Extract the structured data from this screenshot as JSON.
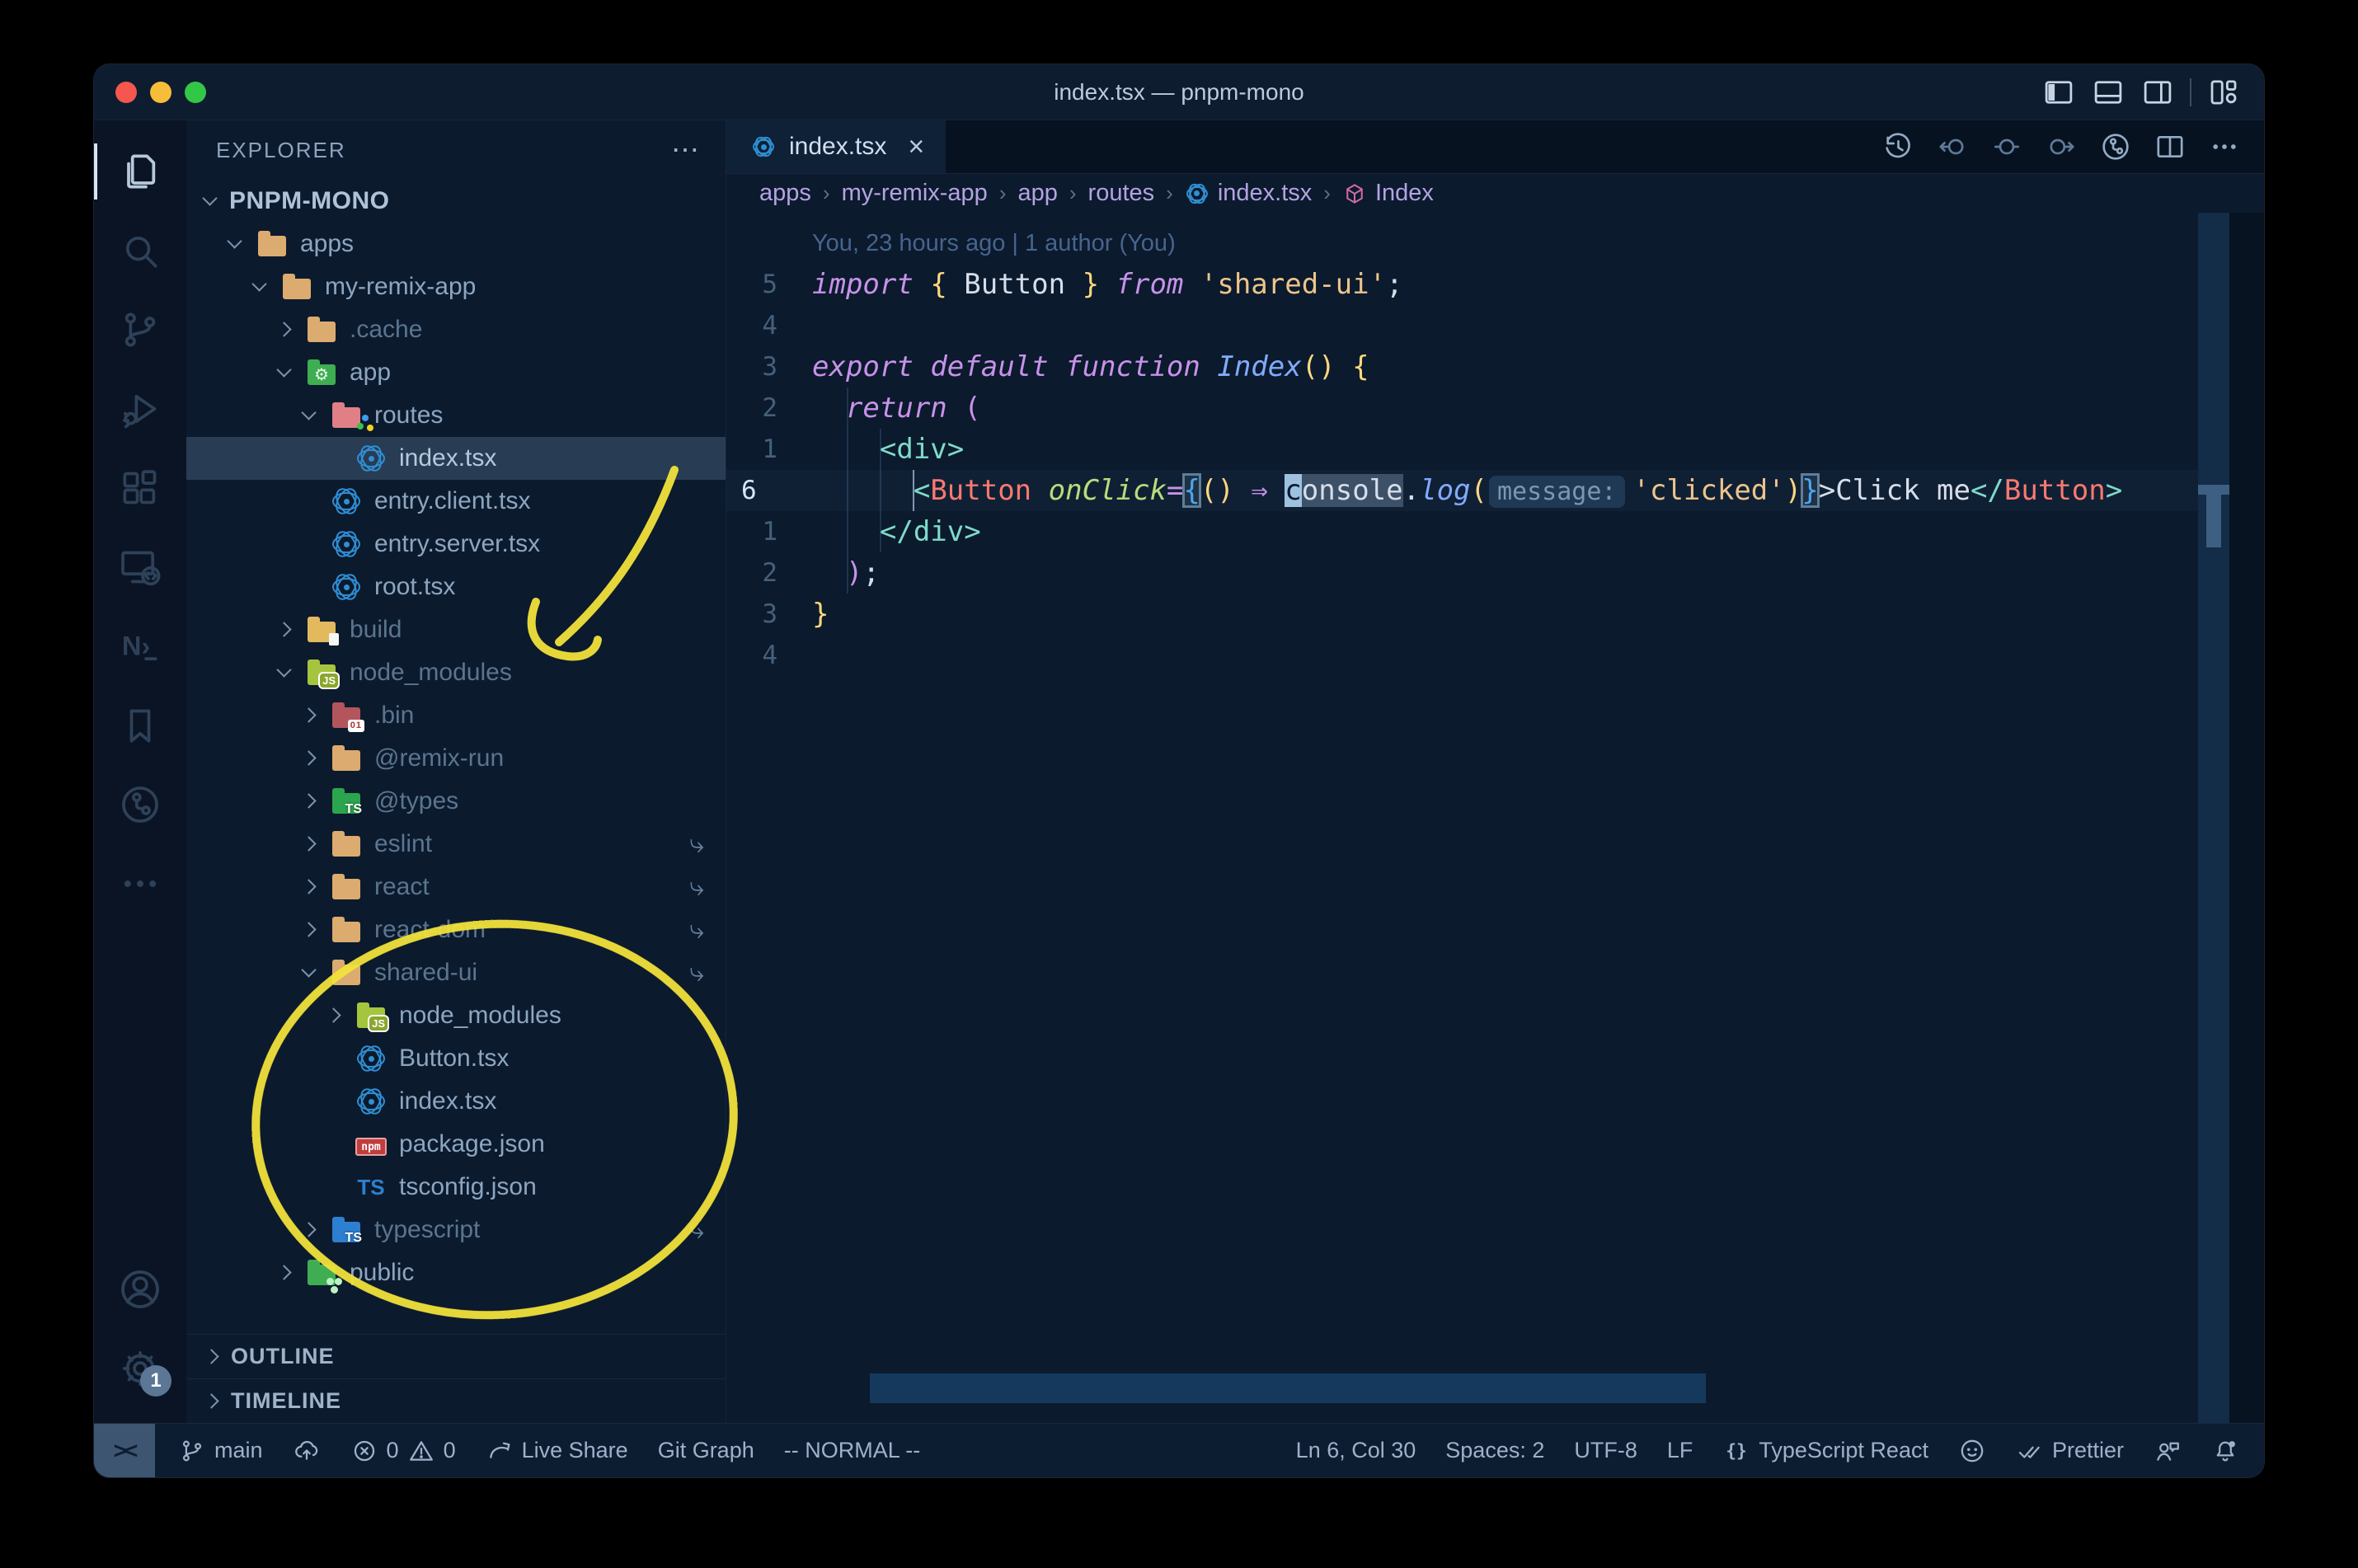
{
  "title_bar": {
    "title": "index.tsx — pnpm-mono",
    "window_controls": [
      "close",
      "minimize",
      "zoom"
    ],
    "layout_icons": [
      "toggle-primary-sidebar",
      "toggle-panel",
      "toggle-secondary-sidebar",
      "customize-layout"
    ]
  },
  "activity_bar": {
    "items": [
      {
        "name": "explorer",
        "icon": "files",
        "active": true
      },
      {
        "name": "search",
        "icon": "search"
      },
      {
        "name": "source-control",
        "icon": "branch"
      },
      {
        "name": "run-and-debug",
        "icon": "debug"
      },
      {
        "name": "extensions",
        "icon": "extensions"
      },
      {
        "name": "remote-explorer",
        "icon": "remote"
      },
      {
        "name": "nx-console",
        "icon": "nx"
      },
      {
        "name": "bookmarks",
        "icon": "bookmark"
      },
      {
        "name": "gitlens",
        "icon": "gitlens"
      },
      {
        "name": "additional-views",
        "icon": "more"
      }
    ],
    "bottom": [
      {
        "name": "accounts",
        "icon": "account"
      },
      {
        "name": "settings",
        "icon": "gear",
        "badge": "1"
      }
    ]
  },
  "sidebar": {
    "header": "EXPLORER",
    "sections": [
      {
        "label": "OUTLINE"
      },
      {
        "label": "TIMELINE"
      }
    ],
    "tree": [
      {
        "level": 0,
        "label": "PNPM-MONO",
        "chevron": "down",
        "root": true
      },
      {
        "level": 1,
        "label": "apps",
        "chevron": "down",
        "icon": "folder-tan"
      },
      {
        "level": 2,
        "label": "my-remix-app",
        "chevron": "down",
        "icon": "folder-tan"
      },
      {
        "level": 3,
        "label": ".cache",
        "chevron": "right",
        "icon": "folder-tan",
        "dim": true
      },
      {
        "level": 3,
        "label": "app",
        "chevron": "down",
        "icon": "folder-app"
      },
      {
        "level": 4,
        "label": "routes",
        "chevron": "down",
        "icon": "folder-routes"
      },
      {
        "level": 5,
        "label": "index.tsx",
        "icon": "react",
        "selected": true
      },
      {
        "level": 4,
        "label": "entry.client.tsx",
        "icon": "react"
      },
      {
        "level": 4,
        "label": "entry.server.tsx",
        "icon": "react"
      },
      {
        "level": 4,
        "label": "root.tsx",
        "icon": "react"
      },
      {
        "level": 3,
        "label": "build",
        "chevron": "right",
        "icon": "folder-build",
        "dim": true
      },
      {
        "level": 3,
        "label": "node_modules",
        "chevron": "down",
        "icon": "folder-nm",
        "dim": true
      },
      {
        "level": 4,
        "label": ".bin",
        "chevron": "right",
        "icon": "folder-bin",
        "dim": true
      },
      {
        "level": 4,
        "label": "@remix-run",
        "chevron": "right",
        "icon": "folder-tan",
        "dim": true
      },
      {
        "level": 4,
        "label": "@types",
        "chevron": "right",
        "icon": "folder-types",
        "dim": true
      },
      {
        "level": 4,
        "label": "eslint",
        "chevron": "right",
        "icon": "folder-tan",
        "dim": true,
        "symlink": true
      },
      {
        "level": 4,
        "label": "react",
        "chevron": "right",
        "icon": "folder-tan",
        "dim": true,
        "symlink": true
      },
      {
        "level": 4,
        "label": "react-dom",
        "chevron": "right",
        "icon": "folder-tan",
        "dim": true,
        "symlink": true
      },
      {
        "level": 4,
        "label": "shared-ui",
        "chevron": "down",
        "icon": "folder-tan",
        "dim": true,
        "symlink": true
      },
      {
        "level": 5,
        "label": "node_modules",
        "chevron": "right",
        "icon": "folder-nm"
      },
      {
        "level": 5,
        "label": "Button.tsx",
        "icon": "react"
      },
      {
        "level": 5,
        "label": "index.tsx",
        "icon": "react"
      },
      {
        "level": 5,
        "label": "package.json",
        "icon": "npm"
      },
      {
        "level": 5,
        "label": "tsconfig.json",
        "icon": "ts"
      },
      {
        "level": 4,
        "label": "typescript",
        "chevron": "right",
        "icon": "folder-tsblue",
        "dim": true,
        "symlink": true
      },
      {
        "level": 3,
        "label": "public",
        "chevron": "right",
        "icon": "folder-public"
      }
    ]
  },
  "editor_tabs": [
    {
      "label": "index.tsx",
      "icon": "react",
      "active": true
    }
  ],
  "editor_toolbar": [
    {
      "name": "history"
    },
    {
      "name": "navigate-back"
    },
    {
      "name": "navigate-current"
    },
    {
      "name": "navigate-forward"
    },
    {
      "name": "gitlens"
    },
    {
      "name": "split-editor"
    },
    {
      "name": "more-actions"
    }
  ],
  "breadcrumbs": [
    {
      "label": "apps"
    },
    {
      "label": "my-remix-app"
    },
    {
      "label": "app"
    },
    {
      "label": "routes"
    },
    {
      "label": "index.tsx",
      "icon": "react"
    },
    {
      "label": "Index",
      "icon": "symbol-component"
    }
  ],
  "editor": {
    "blame": "You, 23 hours ago | 1 author (You)",
    "lines": [
      {
        "num": "5",
        "spans": [
          {
            "c": "kw",
            "t": "import"
          },
          {
            "t": " "
          },
          {
            "c": "gold",
            "t": "{"
          },
          {
            "t": " Button "
          },
          {
            "c": "gold",
            "t": "}"
          },
          {
            "c": "kw",
            "t": " from"
          },
          {
            "t": " "
          },
          {
            "c": "str",
            "t": "'shared-ui'"
          },
          {
            "t": ";"
          }
        ]
      },
      {
        "num": "4",
        "spans": []
      },
      {
        "num": "3",
        "spans": [
          {
            "c": "kw",
            "t": "export"
          },
          {
            "t": " "
          },
          {
            "c": "kw",
            "t": "default"
          },
          {
            "t": " "
          },
          {
            "c": "kw",
            "t": "function"
          },
          {
            "t": " "
          },
          {
            "c": "fn",
            "t": "Index"
          },
          {
            "c": "gold",
            "t": "()"
          },
          {
            "t": " "
          },
          {
            "c": "gold",
            "t": "{"
          }
        ]
      },
      {
        "num": "2",
        "spans": [
          {
            "t": "  "
          },
          {
            "c": "kw",
            "t": "return"
          },
          {
            "t": " "
          },
          {
            "c": "pink",
            "t": "("
          }
        ]
      },
      {
        "num": "1",
        "spans": [
          {
            "t": "    "
          },
          {
            "c": "tagb",
            "t": "<div>"
          }
        ]
      },
      {
        "num": "6",
        "current": true,
        "spans": [
          {
            "t": "      "
          },
          {
            "c": "tagb",
            "t": "<"
          },
          {
            "c": "tagr",
            "t": "Button"
          },
          {
            "t": " "
          },
          {
            "c": "attr",
            "t": "onClick"
          },
          {
            "c": "pink",
            "t": "="
          },
          {
            "c": "blue box",
            "t": "{"
          },
          {
            "c": "gold",
            "t": "()"
          },
          {
            "t": " "
          },
          {
            "c": "pink",
            "t": "⇒"
          },
          {
            "t": " "
          },
          {
            "c": "cursor",
            "t": "c"
          },
          {
            "c": "hl",
            "t": "onsole"
          },
          {
            "t": "."
          },
          {
            "c": "fn",
            "t": "log"
          },
          {
            "c": "gold",
            "t": "("
          },
          {
            "c": "inlay",
            "t": "message:"
          },
          {
            "c": "str",
            "t": "'clicked'"
          },
          {
            "c": "gold",
            "t": ")"
          },
          {
            "c": "blue box",
            "t": "}"
          },
          {
            "t": ">"
          },
          {
            "t": "Click me"
          },
          {
            "c": "tagb",
            "t": "</"
          },
          {
            "c": "tagr",
            "t": "Button"
          },
          {
            "c": "tagb",
            "t": ">"
          }
        ]
      },
      {
        "num": "1",
        "spans": [
          {
            "t": "    "
          },
          {
            "c": "tagb",
            "t": "</div>"
          }
        ]
      },
      {
        "num": "2",
        "spans": [
          {
            "t": "  "
          },
          {
            "c": "pink",
            "t": ")"
          },
          {
            "t": ";"
          }
        ]
      },
      {
        "num": "3",
        "spans": [
          {
            "c": "gold",
            "t": "}"
          }
        ]
      },
      {
        "num": "4",
        "spans": []
      }
    ]
  },
  "status_bar": {
    "remote_glyph": "><",
    "left": [
      {
        "name": "git-branch",
        "icon": "branch-sm",
        "text": "main"
      },
      {
        "name": "publish-changes",
        "icon": "cloud"
      },
      {
        "name": "problems",
        "icon": "problems",
        "errors": "0",
        "warnings": "0"
      },
      {
        "name": "live-share",
        "icon": "liveshare",
        "text": "Live Share"
      },
      {
        "name": "git-graph",
        "text": "Git Graph"
      },
      {
        "name": "vim-mode",
        "text": "-- NORMAL --"
      }
    ],
    "right": [
      {
        "name": "cursor-position",
        "text": "Ln 6, Col 30"
      },
      {
        "name": "indentation",
        "text": "Spaces: 2"
      },
      {
        "name": "encoding",
        "text": "UTF-8"
      },
      {
        "name": "eol-sequence",
        "text": "LF"
      },
      {
        "name": "language-mode",
        "icon": "braces",
        "text": "TypeScript React"
      },
      {
        "name": "github",
        "icon": "octoface"
      },
      {
        "name": "prettier",
        "icon": "checks",
        "text": "Prettier"
      },
      {
        "name": "feedback",
        "icon": "feedback"
      },
      {
        "name": "notifications",
        "icon": "bell"
      }
    ]
  },
  "annotations": {
    "highlight_color": "#f2e23c",
    "shapes": [
      "hand-drawn-arrow",
      "hand-drawn-ellipse"
    ]
  },
  "colors": {
    "accent_yellow": "#f2e23c",
    "react_blue": "#2f8fd4",
    "keyword_pink": "#c792ea",
    "string_peach": "#ecc48d",
    "tag_coral": "#fa7970",
    "tag_teal": "#7fdbca"
  }
}
